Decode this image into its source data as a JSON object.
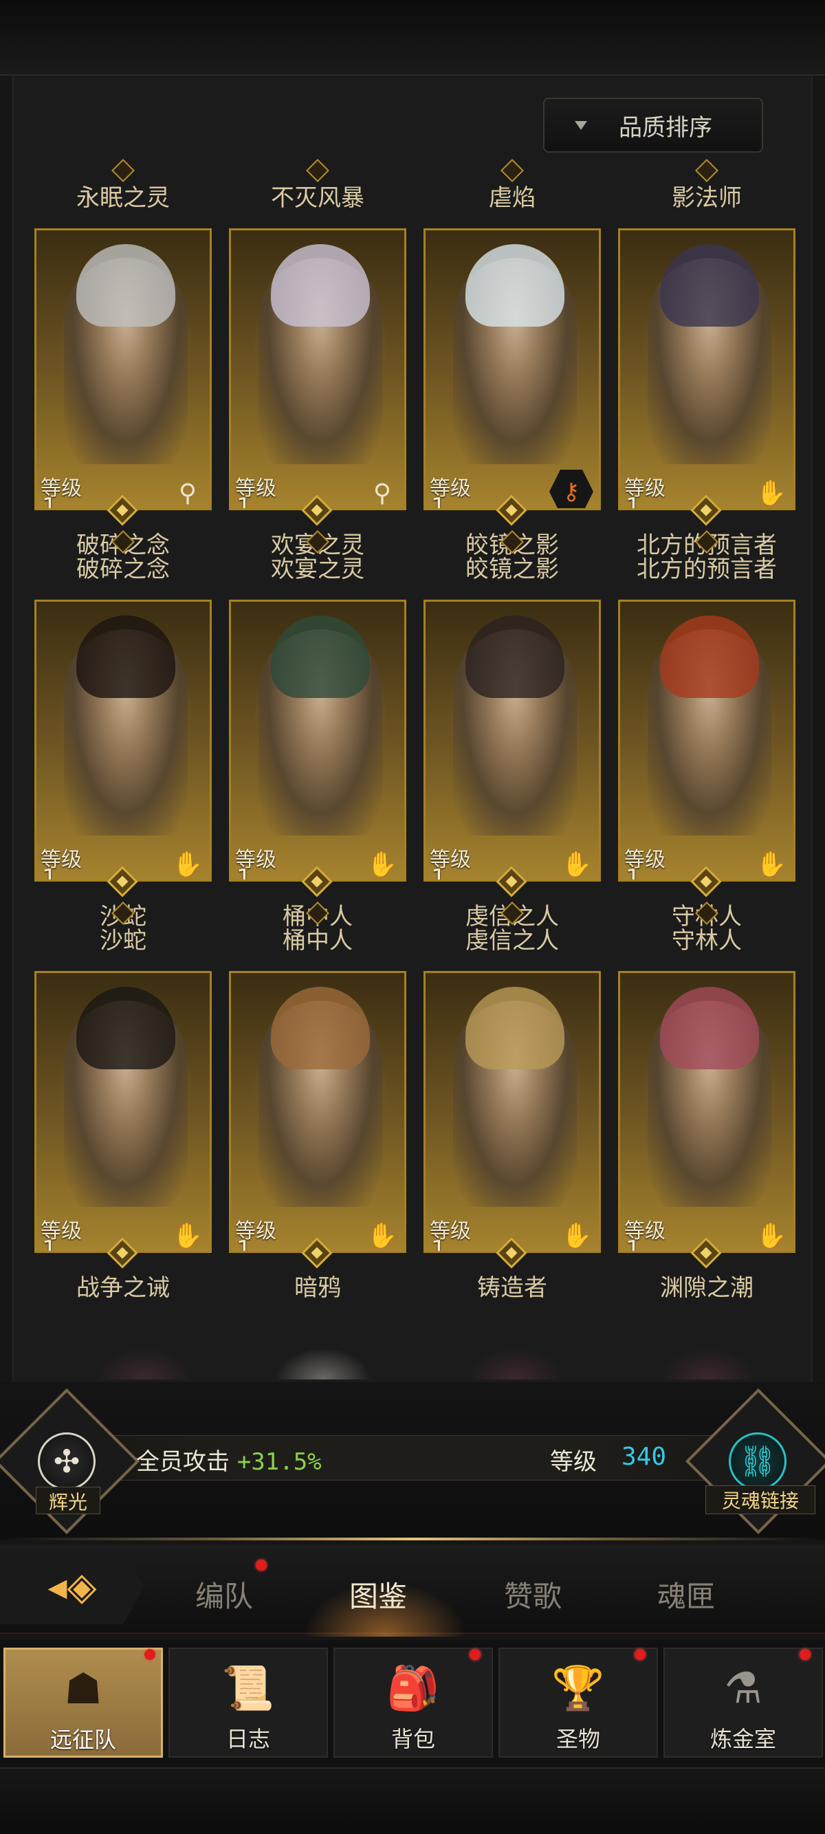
{
  "sort_button": {
    "label": "品质排序"
  },
  "heroes": [
    {
      "top_name": "永眠之灵",
      "level_label": "等级",
      "level": "1",
      "class_icon": "wand-icon",
      "bottom_name": "破碎之念",
      "palette": "#bfbfbf"
    },
    {
      "top_name": "不灭风暴",
      "level_label": "等级",
      "level": "1",
      "class_icon": "wand-icon",
      "bottom_name": "欢宴之灵",
      "palette": "#c9c3d6"
    },
    {
      "top_name": "虐焰",
      "level_label": "等级",
      "level": "1",
      "class_icon": "key-badge-icon",
      "bottom_name": "皎镜之影",
      "palette": "#d7e3ea"
    },
    {
      "top_name": "影法师",
      "level_label": "等级",
      "level": "1",
      "class_icon": "hand-icon",
      "bottom_name": "北方的预言者",
      "palette": "#3a3550"
    },
    {
      "top_name": "破碎之念",
      "level_label": "等级",
      "level": "1",
      "class_icon": "hand-icon",
      "bottom_name": "沙蛇",
      "palette": "#1b1410"
    },
    {
      "top_name": "欢宴之灵",
      "level_label": "等级",
      "level": "1",
      "class_icon": "hand-icon",
      "bottom_name": "桶中人",
      "palette": "#2d4a3a"
    },
    {
      "top_name": "皎镜之影",
      "level_label": "等级",
      "level": "1",
      "class_icon": "hand-icon",
      "bottom_name": "虔信之人",
      "palette": "#2a2220"
    },
    {
      "top_name": "北方的预言者",
      "level_label": "等级",
      "level": "1",
      "class_icon": "hand-icon",
      "bottom_name": "守林人",
      "palette": "#a63a1d"
    },
    {
      "top_name": "沙蛇",
      "level_label": "等级",
      "level": "1",
      "class_icon": "hand-icon",
      "bottom_name": "战争之诫",
      "palette": "#1a1814"
    },
    {
      "top_name": "桶中人",
      "level_label": "等级",
      "level": "1",
      "class_icon": "hand-icon",
      "bottom_name": "暗鸦",
      "palette": "#9b6a3a"
    },
    {
      "top_name": "虔信之人",
      "level_label": "等级",
      "level": "1",
      "class_icon": "hand-icon",
      "bottom_name": "铸造者",
      "palette": "#b99a56"
    },
    {
      "top_name": "守林人",
      "level_label": "等级",
      "level": "1",
      "class_icon": "hand-icon",
      "bottom_name": "渊隙之潮",
      "palette": "#a34a5a"
    }
  ],
  "bonus": {
    "radiance_label": "辉光",
    "team_attack_label": "全员攻击",
    "team_attack_value": "+31.5%",
    "level_label": "等级",
    "level_value": "340",
    "soul_link_label": "灵魂链接"
  },
  "tabs": [
    {
      "label": "编队",
      "badge": true
    },
    {
      "label": "图鉴",
      "active": true
    },
    {
      "label": "赞歌"
    },
    {
      "label": "魂匣"
    }
  ],
  "bottom_nav": [
    {
      "label": "远征队",
      "icon": "helmet-icon",
      "active": true,
      "badge": true
    },
    {
      "label": "日志",
      "icon": "scroll-icon",
      "badge": false
    },
    {
      "label": "背包",
      "icon": "backpack-icon",
      "badge": true
    },
    {
      "label": "圣物",
      "icon": "chalice-icon",
      "badge": true
    },
    {
      "label": "炼金室",
      "icon": "alchemy-icon",
      "badge": true
    }
  ]
}
